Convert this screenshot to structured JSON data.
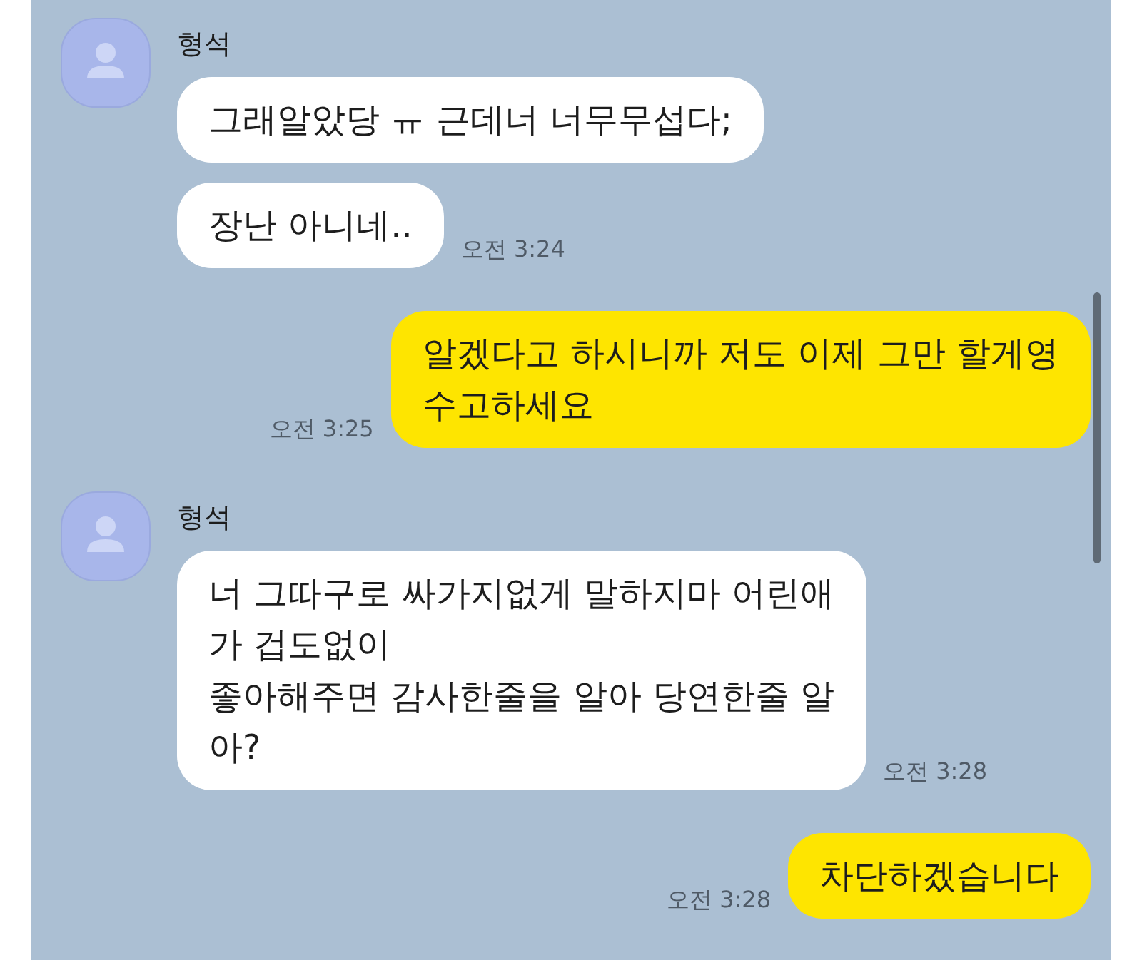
{
  "messages": [
    {
      "kind": "received",
      "sender": "형석",
      "bubbles": [
        "그래알았당 ㅠ 근데너 너무무섭다;",
        "장난 아니네.."
      ],
      "time": "오전 3:24"
    },
    {
      "kind": "sent",
      "bubbles": [
        "알겠다고 하시니까 저도 이제 그만 할게영\n수고하세요"
      ],
      "time": "오전 3:25"
    },
    {
      "kind": "received",
      "sender": "형석",
      "bubbles": [
        "너 그따구로 싸가지없게 말하지마 어린애\n가 겁도없이\n좋아해주면 감사한줄을 알아 당연한줄 알\n아?"
      ],
      "time": "오전 3:28"
    },
    {
      "kind": "sent",
      "bubbles": [
        "차단하겠습니다"
      ],
      "time": "오전 3:28"
    }
  ]
}
